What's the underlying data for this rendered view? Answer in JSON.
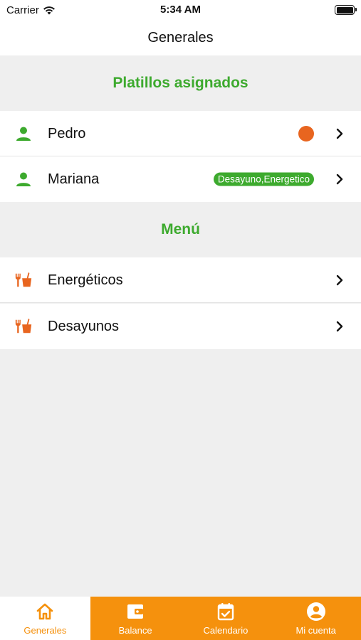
{
  "status_bar": {
    "carrier": "Carrier",
    "time": "5:34 AM"
  },
  "nav": {
    "title": "Generales"
  },
  "sections": {
    "assigned": {
      "title": "Platillos asignados",
      "items": [
        {
          "name": "Pedro",
          "icon": "person-icon",
          "indicator": "orange-dot"
        },
        {
          "name": "Mariana",
          "icon": "person-icon",
          "tag": "Desayuno,Energetico"
        }
      ]
    },
    "menu": {
      "title": "Menú",
      "items": [
        {
          "name": "Energéticos",
          "icon": "food-drink-icon"
        },
        {
          "name": "Desayunos",
          "icon": "food-drink-icon"
        }
      ]
    }
  },
  "tabs": [
    {
      "label": "Generales",
      "icon": "home-icon",
      "active": true
    },
    {
      "label": "Balance",
      "icon": "wallet-icon",
      "active": false
    },
    {
      "label": "Calendario",
      "icon": "calendar-check-icon",
      "active": false
    },
    {
      "label": "Mi cuenta",
      "icon": "account-icon",
      "active": false
    }
  ],
  "colors": {
    "accent_green": "#3daa2e",
    "accent_orange": "#f5910d",
    "dot_orange": "#e8651f",
    "background": "#efefef"
  }
}
